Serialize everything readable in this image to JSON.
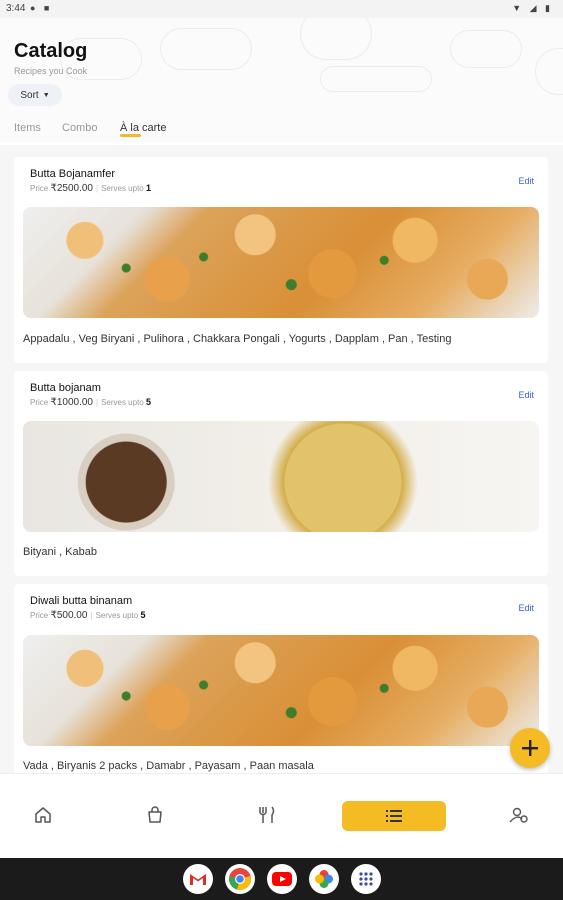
{
  "status_bar": {
    "time": "3:44"
  },
  "header": {
    "title": "Catalog",
    "subtitle": "Recipes you Cook",
    "sort_label": "Sort"
  },
  "tabs": [
    {
      "label": "Items"
    },
    {
      "label": "Combo"
    },
    {
      "label": "À la carte",
      "active": true
    }
  ],
  "labels": {
    "price": "Price",
    "serves": "Serves upto",
    "edit": "Edit"
  },
  "cards": [
    {
      "name": "Butta Bojanamfer",
      "price": "₹2500.00",
      "serves": "1",
      "items": "Appadalu , Veg Biryani , Pulihora , Chakkara Pongali , Yogurts , Dapplam , Pan , Testing",
      "image": "cauliflower-dish"
    },
    {
      "name": "Butta bojanam",
      "price": "₹1000.00",
      "serves": "5",
      "items": "Bityani , Kabab",
      "image": "biryani-dish"
    },
    {
      "name": "Diwali butta binanam",
      "price": "₹500.00",
      "serves": "5",
      "items": "Vada , Biryanis 2 packs , Damabr , Payasam , Paan masala",
      "image": "cauliflower-dish"
    }
  ],
  "fab": {
    "icon": "plus-icon"
  },
  "nav": [
    {
      "icon": "home-icon"
    },
    {
      "icon": "shopping-bag-icon"
    },
    {
      "icon": "cutlery-icon"
    },
    {
      "icon": "list-icon",
      "active": true
    },
    {
      "icon": "people-settings-icon"
    }
  ],
  "dock": [
    {
      "icon": "gmail-icon"
    },
    {
      "icon": "chrome-icon"
    },
    {
      "icon": "youtube-icon"
    },
    {
      "icon": "photos-icon"
    },
    {
      "icon": "apps-icon"
    }
  ],
  "colors": {
    "accent": "#f5bb25",
    "link": "#3a63d6",
    "system_bar": "#1b1b1b"
  }
}
